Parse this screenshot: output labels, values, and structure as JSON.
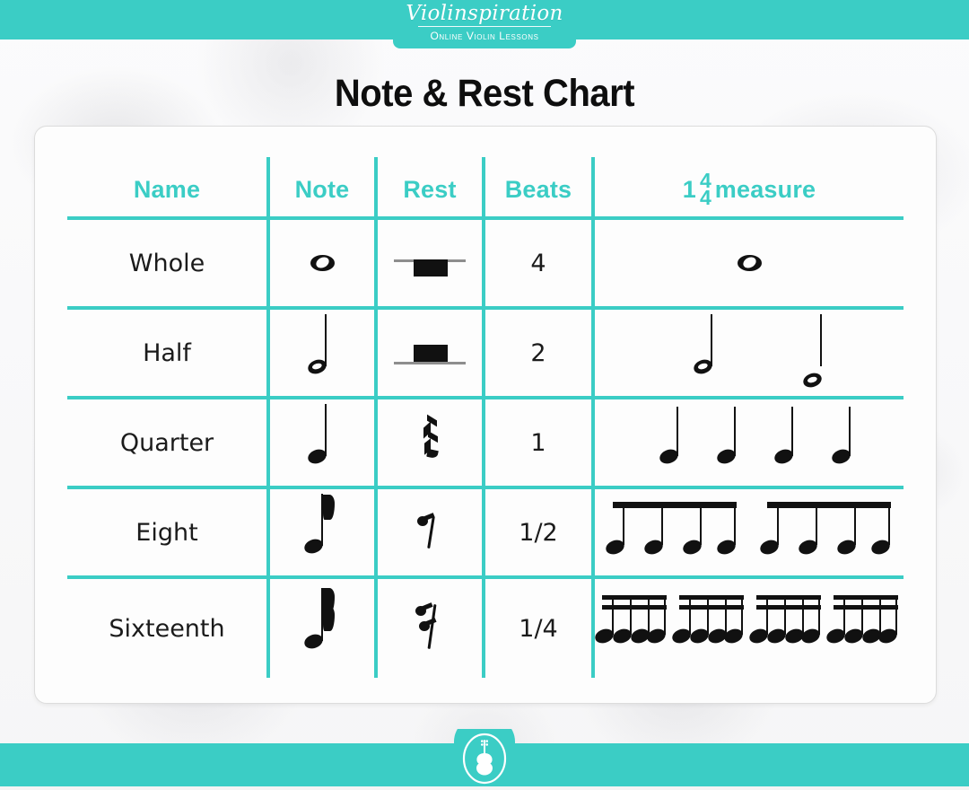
{
  "brand": {
    "script": "Violinspiration",
    "subtitle": "Online Violin Lessons",
    "teal": "#3bcdc5",
    "logo_icon": "violin-icon"
  },
  "page_title": "Note & Rest Chart",
  "table": {
    "headers": {
      "name": "Name",
      "note": "Note",
      "rest": "Rest",
      "beats": "Beats",
      "measure_prefix": "1",
      "measure_time_top": "4",
      "measure_time_bottom": "4",
      "measure_suffix": "measure"
    },
    "rows": [
      {
        "name": "Whole",
        "beats": "4",
        "note_glyph": "whole-note",
        "rest_glyph": "whole-rest",
        "measure_glyph": "one-whole-note",
        "measure_count": 1
      },
      {
        "name": "Half",
        "beats": "2",
        "note_glyph": "half-note",
        "rest_glyph": "half-rest",
        "measure_glyph": "two-half-notes",
        "measure_count": 2
      },
      {
        "name": "Quarter",
        "beats": "1",
        "note_glyph": "quarter-note",
        "rest_glyph": "quarter-rest",
        "measure_glyph": "four-quarter-notes",
        "measure_count": 4
      },
      {
        "name": "Eight",
        "beats": "1/2",
        "note_glyph": "eighth-note",
        "rest_glyph": "eighth-rest",
        "measure_glyph": "eight-beamed-eighth-notes",
        "measure_count": 8
      },
      {
        "name": "Sixteenth",
        "beats": "1/4",
        "note_glyph": "sixteenth-note",
        "rest_glyph": "sixteenth-rest",
        "measure_glyph": "sixteen-beamed-sixteenth-notes",
        "measure_count": 16
      }
    ]
  },
  "footer": {
    "badge_icon": "violin-badge-icon"
  }
}
